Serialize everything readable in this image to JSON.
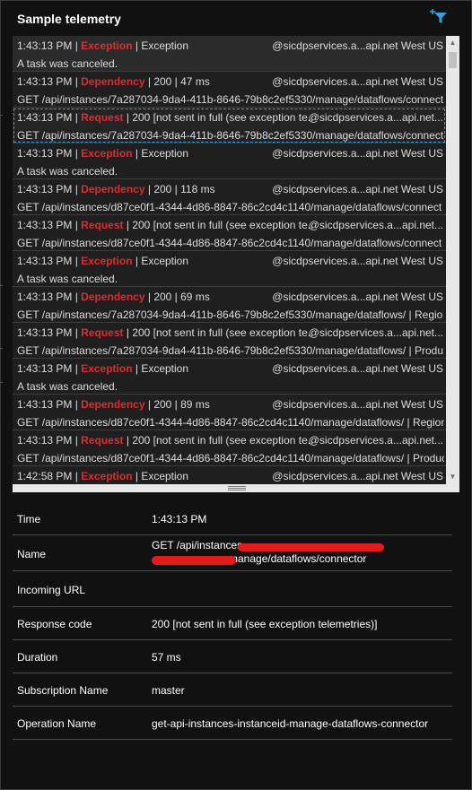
{
  "panel": {
    "title": "Sample telemetry",
    "filter_icon": "filter-add-icon",
    "accent_color": "#3c9fd9",
    "type_color": "#e02c2c"
  },
  "telemetry": [
    {
      "time": "1:43:13 PM",
      "type": "Exception",
      "info": "Exception",
      "source": "@sicdpservices.a...api.net West US",
      "detail": "A task was canceled."
    },
    {
      "time": "1:43:13 PM",
      "type": "Dependency",
      "info": "200 | 47 ms",
      "source": "@sicdpservices.a...api.net West US",
      "detail": "GET /api/instances/7a287034-9da4-411b-8646-79b8c2ef5330/manage/dataflows/connect"
    },
    {
      "time": "1:43:13 PM",
      "type": "Request",
      "info": "200 [not sent in full (see exception te...",
      "source": "@sicdpservices.a...api.net...",
      "detail": "GET /api/instances/7a287034-9da4-411b-8646-79b8c2ef5330/manage/dataflows/connect"
    },
    {
      "time": "1:43:13 PM",
      "type": "Exception",
      "info": "Exception",
      "source": "@sicdpservices.a...api.net West US",
      "detail": "A task was canceled."
    },
    {
      "time": "1:43:13 PM",
      "type": "Dependency",
      "info": "200 | 118 ms",
      "source": "@sicdpservices.a...api.net West US",
      "detail": "GET /api/instances/d87ce0f1-4344-4d86-8847-86c2cd4c1140/manage/dataflows/connect"
    },
    {
      "time": "1:43:13 PM",
      "type": "Request",
      "info": "200 [not sent in full (see exception te...",
      "source": "@sicdpservices.a...api.net...",
      "detail": "GET /api/instances/d87ce0f1-4344-4d86-8847-86c2cd4c1140/manage/dataflows/connect"
    },
    {
      "time": "1:43:13 PM",
      "type": "Exception",
      "info": "Exception",
      "source": "@sicdpservices.a...api.net West US",
      "detail": "A task was canceled."
    },
    {
      "time": "1:43:13 PM",
      "type": "Dependency",
      "info": "200 | 69 ms",
      "source": "@sicdpservices.a...api.net West US",
      "detail": "GET /api/instances/7a287034-9da4-411b-8646-79b8c2ef5330/manage/dataflows/ | Regio"
    },
    {
      "time": "1:43:13 PM",
      "type": "Request",
      "info": "200 [not sent in full (see exception te...",
      "source": "@sicdpservices.a...api.net...",
      "detail": "GET /api/instances/7a287034-9da4-411b-8646-79b8c2ef5330/manage/dataflows/ | Produ"
    },
    {
      "time": "1:43:13 PM",
      "type": "Exception",
      "info": "Exception",
      "source": "@sicdpservices.a...api.net West US",
      "detail": "A task was canceled."
    },
    {
      "time": "1:43:13 PM",
      "type": "Dependency",
      "info": "200 | 89 ms",
      "source": "@sicdpservices.a...api.net West US",
      "detail": "GET /api/instances/d87ce0f1-4344-4d86-8847-86c2cd4c1140/manage/dataflows/ | Region"
    },
    {
      "time": "1:43:13 PM",
      "type": "Request",
      "info": "200 [not sent in full (see exception te...",
      "source": "@sicdpservices.a...api.net...",
      "detail": "GET /api/instances/d87ce0f1-4344-4d86-8847-86c2cd4c1140/manage/dataflows/ | Produc"
    },
    {
      "time": "1:42:58 PM",
      "type": "Exception",
      "info": "Exception",
      "source": "@sicdpservices.a...api.net West US",
      "detail": ""
    }
  ],
  "details": {
    "time_label": "Time",
    "time_value": "1:43:13 PM",
    "name_label": "Name",
    "name_value_line1": "GET /api/instances",
    "name_value_line2": "manage/dataflows/connector",
    "url_label": "Incoming URL",
    "response_label": "Response code",
    "response_value": "200 [not sent in full (see exception telemetries)]",
    "duration_label": "Duration",
    "duration_value": "57 ms",
    "subscription_label": "Subscription Name",
    "subscription_value": "master",
    "operation_label": "Operation Name",
    "operation_value": "get-api-instances-instanceid-manage-dataflows-connector"
  }
}
